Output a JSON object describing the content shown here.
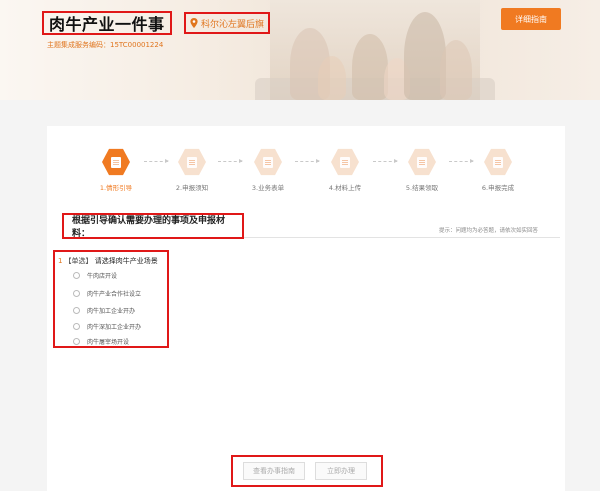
{
  "header": {
    "title": "肉牛产业一件事",
    "location": "科尔沁左翼后旗",
    "service_code": "主题集成服务编码：15TC00001224",
    "guide_button": "详细指南"
  },
  "steps": [
    {
      "label": "1.情形引导",
      "active": true
    },
    {
      "label": "2.申报须知",
      "active": false
    },
    {
      "label": "3.业务表单",
      "active": false
    },
    {
      "label": "4.材料上传",
      "active": false
    },
    {
      "label": "5.结果领取",
      "active": false
    },
    {
      "label": "6.申报完成",
      "active": false
    }
  ],
  "section": {
    "title": "根据引导确认需要办理的事项及申报材料：",
    "hint": "提示：问题均为必答题，请依次如实回答"
  },
  "question": {
    "number": "1",
    "tag": "【单选】",
    "text": "请选择肉牛产业场景",
    "options": [
      "牛肉店开设",
      "肉牛产业合作社设立",
      "肉牛加工企业开办",
      "肉牛深加工企业开办",
      "肉牛屠宰场开设"
    ]
  },
  "actions": {
    "view_guide": "查看办事指南",
    "apply_now": "立即办理"
  },
  "colors": {
    "accent": "#f07a21",
    "highlight_border": "#e01818",
    "step_inactive": "#f7e1cf"
  }
}
